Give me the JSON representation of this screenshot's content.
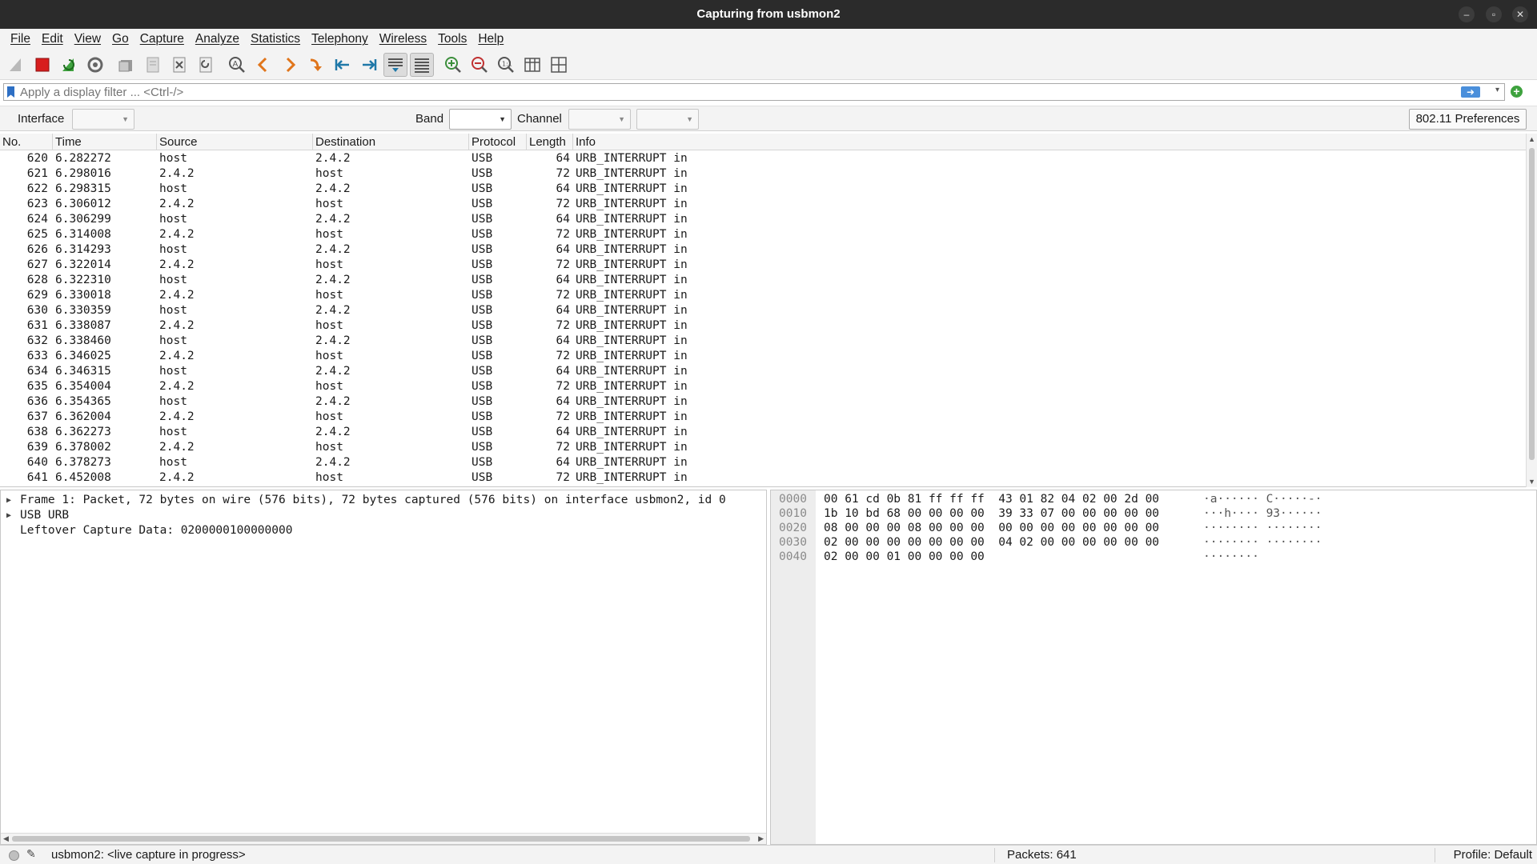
{
  "window": {
    "title": "Capturing from usbmon2"
  },
  "menu": [
    "File",
    "Edit",
    "View",
    "Go",
    "Capture",
    "Analyze",
    "Statistics",
    "Telephony",
    "Wireless",
    "Tools",
    "Help"
  ],
  "toolbar": {
    "icons": [
      "shark-fin-icon",
      "stop-icon",
      "restart-capture-icon",
      "capture-options-icon",
      "open-file-icon",
      "save-file-icon",
      "close-file-icon",
      "reload-icon",
      "find-packet-icon",
      "go-back-icon",
      "go-forward-icon",
      "go-to-packet-icon",
      "first-packet-icon",
      "last-packet-icon",
      "autoscroll-icon",
      "colorize-icon",
      "zoom-in-icon",
      "zoom-out-icon",
      "normal-size-icon",
      "resize-columns-icon",
      "layout-icon"
    ]
  },
  "filter": {
    "placeholder": "Apply a display filter ... <Ctrl-/>",
    "value": ""
  },
  "wireless": {
    "interface_label": "Interface",
    "band_label": "Band",
    "channel_label": "Channel",
    "preferences_label": "802.11 Preferences"
  },
  "packet_list": {
    "columns": [
      "No.",
      "Time",
      "Source",
      "Destination",
      "Protocol",
      "Length",
      "Info"
    ],
    "rows": [
      [
        "620",
        "6.282272",
        "host",
        "2.4.2",
        "USB",
        "64",
        "URB_INTERRUPT in"
      ],
      [
        "621",
        "6.298016",
        "2.4.2",
        "host",
        "USB",
        "72",
        "URB_INTERRUPT in"
      ],
      [
        "622",
        "6.298315",
        "host",
        "2.4.2",
        "USB",
        "64",
        "URB_INTERRUPT in"
      ],
      [
        "623",
        "6.306012",
        "2.4.2",
        "host",
        "USB",
        "72",
        "URB_INTERRUPT in"
      ],
      [
        "624",
        "6.306299",
        "host",
        "2.4.2",
        "USB",
        "64",
        "URB_INTERRUPT in"
      ],
      [
        "625",
        "6.314008",
        "2.4.2",
        "host",
        "USB",
        "72",
        "URB_INTERRUPT in"
      ],
      [
        "626",
        "6.314293",
        "host",
        "2.4.2",
        "USB",
        "64",
        "URB_INTERRUPT in"
      ],
      [
        "627",
        "6.322014",
        "2.4.2",
        "host",
        "USB",
        "72",
        "URB_INTERRUPT in"
      ],
      [
        "628",
        "6.322310",
        "host",
        "2.4.2",
        "USB",
        "64",
        "URB_INTERRUPT in"
      ],
      [
        "629",
        "6.330018",
        "2.4.2",
        "host",
        "USB",
        "72",
        "URB_INTERRUPT in"
      ],
      [
        "630",
        "6.330359",
        "host",
        "2.4.2",
        "USB",
        "64",
        "URB_INTERRUPT in"
      ],
      [
        "631",
        "6.338087",
        "2.4.2",
        "host",
        "USB",
        "72",
        "URB_INTERRUPT in"
      ],
      [
        "632",
        "6.338460",
        "host",
        "2.4.2",
        "USB",
        "64",
        "URB_INTERRUPT in"
      ],
      [
        "633",
        "6.346025",
        "2.4.2",
        "host",
        "USB",
        "72",
        "URB_INTERRUPT in"
      ],
      [
        "634",
        "6.346315",
        "host",
        "2.4.2",
        "USB",
        "64",
        "URB_INTERRUPT in"
      ],
      [
        "635",
        "6.354004",
        "2.4.2",
        "host",
        "USB",
        "72",
        "URB_INTERRUPT in"
      ],
      [
        "636",
        "6.354365",
        "host",
        "2.4.2",
        "USB",
        "64",
        "URB_INTERRUPT in"
      ],
      [
        "637",
        "6.362004",
        "2.4.2",
        "host",
        "USB",
        "72",
        "URB_INTERRUPT in"
      ],
      [
        "638",
        "6.362273",
        "host",
        "2.4.2",
        "USB",
        "64",
        "URB_INTERRUPT in"
      ],
      [
        "639",
        "6.378002",
        "2.4.2",
        "host",
        "USB",
        "72",
        "URB_INTERRUPT in"
      ],
      [
        "640",
        "6.378273",
        "host",
        "2.4.2",
        "USB",
        "64",
        "URB_INTERRUPT in"
      ],
      [
        "641",
        "6.452008",
        "2.4.2",
        "host",
        "USB",
        "72",
        "URB_INTERRUPT in"
      ]
    ]
  },
  "details": {
    "rows": [
      {
        "expandable": true,
        "text": "Frame 1: Packet, 72 bytes on wire (576 bits), 72 bytes captured (576 bits) on interface usbmon2, id 0"
      },
      {
        "expandable": true,
        "text": "USB URB"
      },
      {
        "expandable": false,
        "text": "Leftover Capture Data: 0200000100000000"
      }
    ]
  },
  "bytes": {
    "rows": [
      {
        "offset": "0000",
        "hex": "00 61 cd 0b 81 ff ff ff  43 01 82 04 02 00 2d 00",
        "ascii": "·a······ C·····-·"
      },
      {
        "offset": "0010",
        "hex": "1b 10 bd 68 00 00 00 00  39 33 07 00 00 00 00 00",
        "ascii": "···h···· 93······"
      },
      {
        "offset": "0020",
        "hex": "08 00 00 00 08 00 00 00  00 00 00 00 00 00 00 00",
        "ascii": "········ ········"
      },
      {
        "offset": "0030",
        "hex": "02 00 00 00 00 00 00 00  04 02 00 00 00 00 00 00",
        "ascii": "········ ········"
      },
      {
        "offset": "0040",
        "hex": "02 00 00 01 00 00 00 00",
        "ascii": "········"
      }
    ]
  },
  "status": {
    "message": "usbmon2: <live capture in progress>",
    "packets": "Packets: 641",
    "profile": "Profile: Default"
  }
}
